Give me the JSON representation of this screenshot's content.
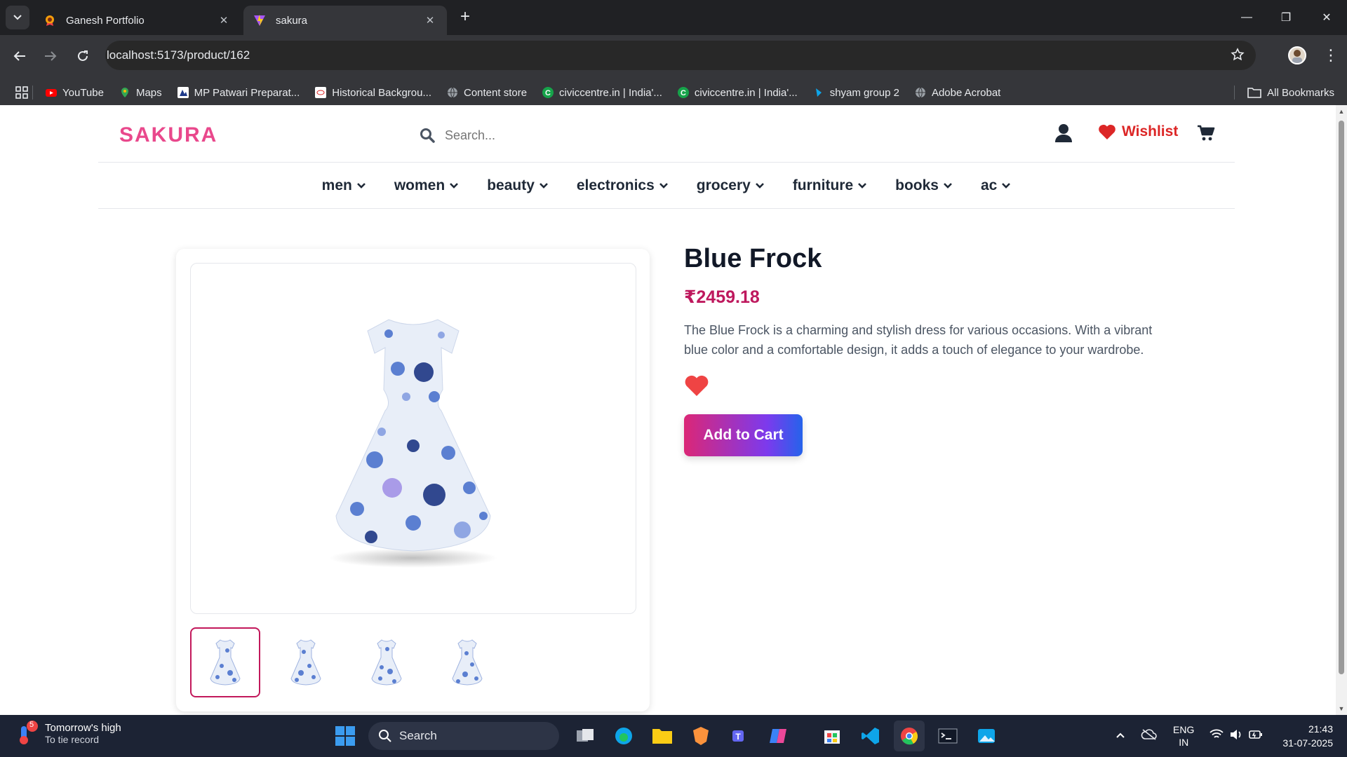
{
  "browser": {
    "tabs": [
      {
        "title": "Ganesh Portfolio",
        "active": false
      },
      {
        "title": "sakura",
        "active": true
      }
    ],
    "url": "localhost:5173/product/162",
    "bookmarks": [
      {
        "label": "YouTube",
        "icon": "youtube-icon"
      },
      {
        "label": "Maps",
        "icon": "maps-icon"
      },
      {
        "label": "MP Patwari Preparat...",
        "icon": "bookmark-icon"
      },
      {
        "label": "Historical Backgrou...",
        "icon": "bookmark-icon"
      },
      {
        "label": "Content store",
        "icon": "globe-icon"
      },
      {
        "label": "civiccentre.in | India'...",
        "icon": "civiccentre-icon"
      },
      {
        "label": "civiccentre.in | India'...",
        "icon": "civiccentre-icon"
      },
      {
        "label": "shyam group 2",
        "icon": "bookmark-icon"
      },
      {
        "label": "Adobe Acrobat",
        "icon": "globe-icon"
      }
    ],
    "all_bookmarks": "All Bookmarks"
  },
  "site": {
    "logo": "SAKURA",
    "search_placeholder": "Search...",
    "wishlist_label": "Wishlist",
    "categories": [
      "men",
      "women",
      "beauty",
      "electronics",
      "grocery",
      "furniture",
      "books",
      "ac"
    ]
  },
  "product": {
    "title": "Blue Frock",
    "price": "₹2459.18",
    "description": "The Blue Frock is a charming and stylish dress for various occasions. With a vibrant blue color and a comfortable design, it adds a touch of elegance to your wardrobe.",
    "add_to_cart": "Add to Cart",
    "thumbnail_count": 4,
    "selected_thumbnail": 1
  },
  "taskbar": {
    "weather_title": "Tomorrow's high",
    "weather_sub": "To tie record",
    "weather_badge": "5",
    "search_label": "Search",
    "lang_line1": "ENG",
    "lang_line2": "IN",
    "time": "21:43",
    "date": "31-07-2025"
  },
  "colors": {
    "brand_pink": "#e9488c",
    "price": "#be185d",
    "wishlist_red": "#dc2626"
  }
}
